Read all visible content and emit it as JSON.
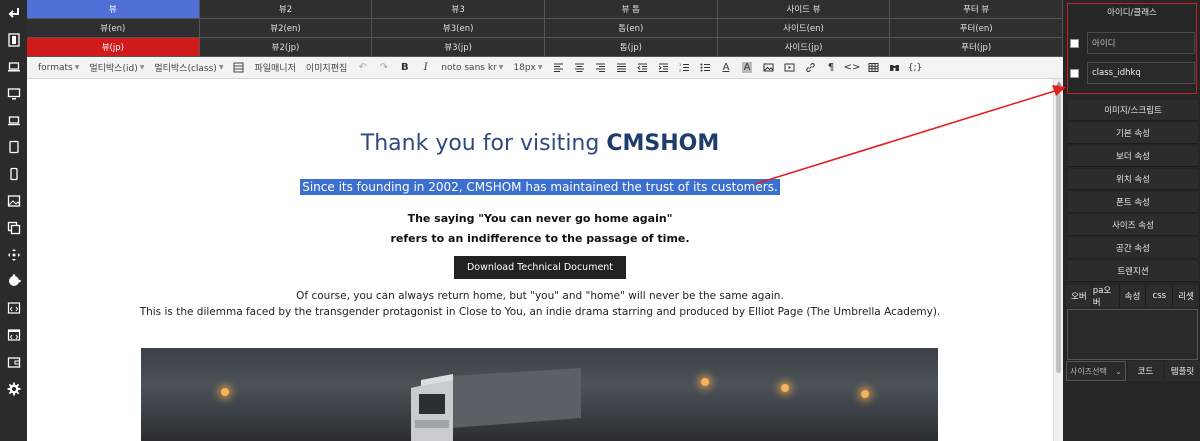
{
  "tabs": {
    "row1": [
      "뷰",
      "뷰2",
      "뷰3",
      "뷰 톱",
      "사이드 뷰",
      "푸터 뷰"
    ],
    "row2": [
      "뷰(en)",
      "뷰2(en)",
      "뷰3(en)",
      "톱(en)",
      "사이드(en)",
      "푸터(en)"
    ],
    "row3": [
      "뷰(jp)",
      "뷰2(jp)",
      "뷰3(jp)",
      "톱(jp)",
      "사이드(jp)",
      "푸터(jp)"
    ]
  },
  "toolbar": {
    "formats": "formats",
    "multibox_id": "멀티박스(id)",
    "multibox_class": "멀티박스(class)",
    "file_manager": "파일매니저",
    "image_edit": "이미지편집",
    "font": "noto sans kr",
    "font_size": "18px"
  },
  "content": {
    "heading_pre": "Thank you for visiting ",
    "heading_brand": "CMSHOM",
    "highlight": "Since its founding in 2002, CMSHOM has maintained the trust of its customers.",
    "saying_line1": "The saying \"You can never go home again\"",
    "saying_line2": "refers to an indifference to the passage of time.",
    "download_button": "Download Technical Document",
    "para_line1": "Of course, you can always return home, but \"you\" and \"home\" will never be the same again.",
    "para_line2": "This is the dilemma faced by the transgender protagonist in Close to You, an indie drama starring and produced by Elliot Page (The Umbrella Academy)."
  },
  "right_panel": {
    "title": "아이디/클래스",
    "id_placeholder": "아이디",
    "class_value": "class_idhkq",
    "buttons": [
      "이미지/스크립트",
      "기본 속성",
      "보더 속성",
      "위치 속성",
      "폰트 속성",
      "사이즈 속성",
      "공간 속성",
      "트렌지션"
    ],
    "tabs": [
      "오버",
      "pa오버",
      "속성",
      "css",
      "리셋"
    ],
    "size_select": "사이즈선택",
    "code_button": "코드",
    "template_button": "템플릿"
  },
  "colors": {
    "accent_blue": "#4f6fd6",
    "accent_red": "#d11a1a",
    "highlight": "#3b6fd0",
    "annotation": "#e02020"
  },
  "icons": {
    "leftbar": [
      "return-icon",
      "film-icon",
      "laptop-icon",
      "desktop-icon",
      "laptop-small-icon",
      "tablet-icon",
      "mobile-icon",
      "image-icon",
      "copy-icon",
      "move-icon",
      "puzzle-icon",
      "code-window-icon",
      "code-browser-icon",
      "wallet-icon",
      "gear-icon"
    ]
  }
}
